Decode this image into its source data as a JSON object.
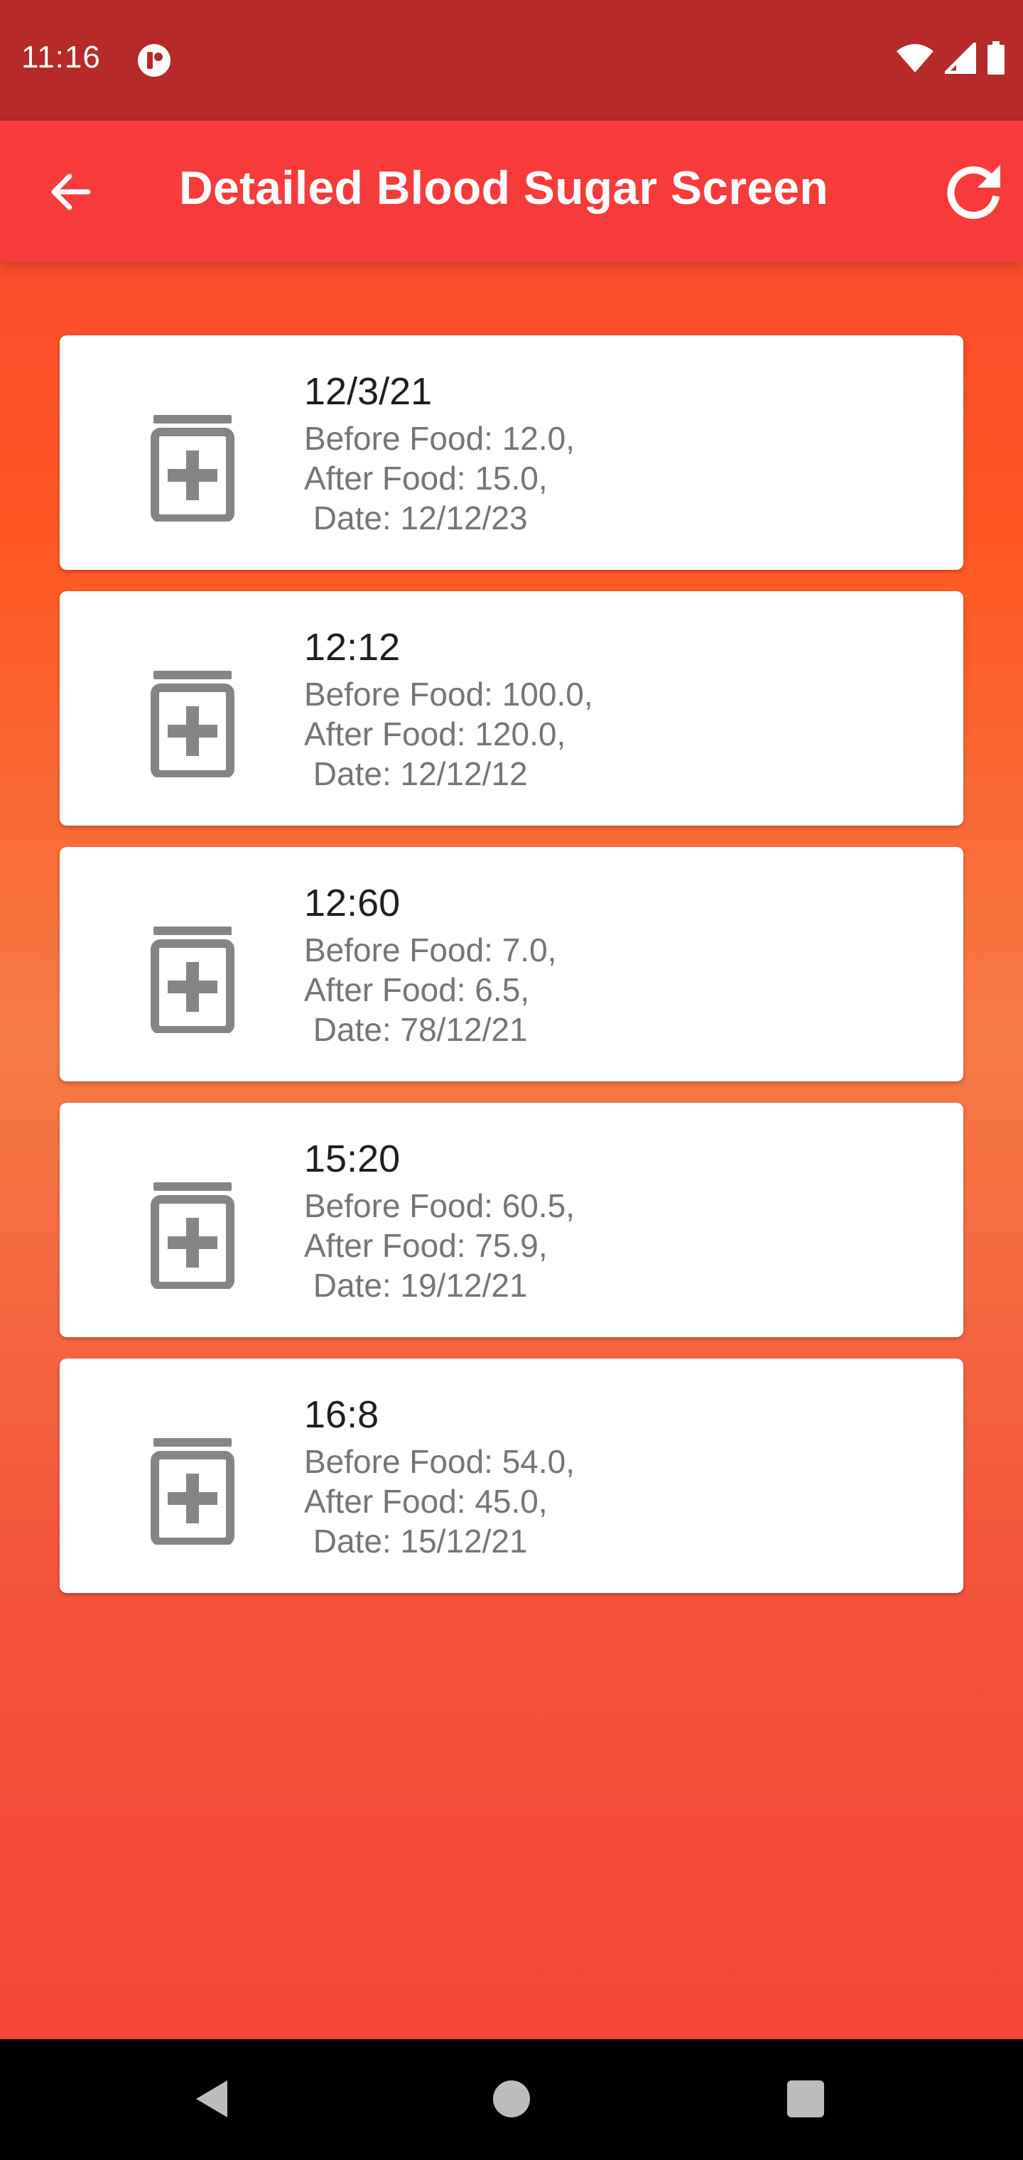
{
  "status_bar": {
    "time": "11:16",
    "icons": [
      "app-notification-icon",
      "wifi-icon",
      "cellular-signal-icon",
      "battery-icon"
    ]
  },
  "app_bar": {
    "title": "Detailed Blood Sugar Screen",
    "back_icon": "arrow-back-icon",
    "refresh_icon": "refresh-icon",
    "background": "#f73b3b"
  },
  "records": [
    {
      "title": "12/3/21",
      "before": "Before Food: 12.0,",
      "after": "After Food: 15.0,",
      "date": " Date: 12/12/23"
    },
    {
      "title": "12:12",
      "before": "Before Food: 100.0,",
      "after": "After Food: 120.0,",
      "date": " Date: 12/12/12"
    },
    {
      "title": "12:60",
      "before": "Before Food: 7.0,",
      "after": "After Food: 6.5,",
      "date": " Date: 78/12/21"
    },
    {
      "title": "15:20",
      "before": "Before Food: 60.5,",
      "after": "After Food: 75.9,",
      "date": " Date: 19/12/21"
    },
    {
      "title": "16:8",
      "before": "Before Food: 54.0,",
      "after": "After Food: 45.0,",
      "date": " Date: 15/12/21"
    }
  ],
  "record_icon": "medication-bottle-icon",
  "nav_bar": {
    "icons": [
      "nav-back-icon",
      "nav-home-icon",
      "nav-recents-icon"
    ]
  },
  "colors": {
    "status_bar": "#b62a2a",
    "gradient": [
      "#f44336",
      "#ff5722",
      "#f67a45",
      "#f44336"
    ],
    "card_text_secondary": "#757575",
    "icon_gray": "#858585"
  }
}
